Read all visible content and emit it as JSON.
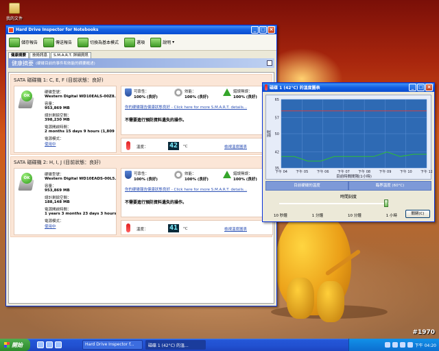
{
  "desktop": {
    "icon_label": "我的文件",
    "stamp": "#1970"
  },
  "main_window": {
    "title": "Hard Drive Inspector for Notebooks",
    "toolbar": [
      {
        "label": "儲存報告"
      },
      {
        "label": "傳送報告"
      },
      {
        "label": "切換為基本模式"
      },
      {
        "label": "選項"
      },
      {
        "label": "說明"
      }
    ],
    "tabs": [
      "健康摘要",
      "技術訊息",
      "S.M.A.R.T. 詳細資訊"
    ],
    "banner_title": "健康摘要",
    "banner_sub": "(硬碟目前的事件和效能的摘要概述)",
    "disks": [
      {
        "header": "SATA 磁碟機 1: C, E, F (目前狀態：良好)",
        "status": "OK",
        "model_label": "硬碟型號：",
        "model": "Western Digital WD10EALS-00Z8...",
        "capacity_label": "容量：",
        "capacity": "953,869 MB",
        "free_label": "總計剩餘空間：",
        "free": "398,230 MB",
        "power_label": "電源開啟時間：",
        "power": "2 months 15 days 9 hours (1,809 ...",
        "mode_label": "電源模式：",
        "mode": "使用中",
        "reliability_label": "可靠性：",
        "reliability": "100% (良好)",
        "performance_label": "效能：",
        "performance": "100% (良好)",
        "errorless_label": "錯誤無誤：",
        "errorless": "100% (良好)",
        "smart_link": "你的硬碟報告健康狀態良好 - Click here for more S.M.A.R.T. details...",
        "advice": "不需要進行預防資料遺失的操作。",
        "temp_label": "溫度：",
        "temp": "42",
        "temp_unit": "°C",
        "temp_link": "檢視溫度圖表"
      },
      {
        "header": "SATA 磁碟機 2: H, I, J (目前狀態：良好)",
        "status": "OK",
        "model_label": "硬碟型號：",
        "model": "Western Digital WD10EADS-00L5...",
        "capacity_label": "容量：",
        "capacity": "953,869 MB",
        "free_label": "總計剩餘空間：",
        "free": "188,148 MB",
        "power_label": "電源開啟時間：",
        "power": "1 years 3 months 23 days 3 hours ...",
        "mode_label": "電源模式：",
        "mode": "使用中",
        "reliability_label": "可靠性：",
        "reliability": "100% (良好)",
        "performance_label": "效能：",
        "performance": "100% (良好)",
        "errorless_label": "錯誤無誤：",
        "errorless": "100% (良好)",
        "smart_link": "你的硬碟報告健康狀態良好 - Click here for more S.M.A.R.T. details...",
        "advice": "不需要進行預防資料遺失的操作。",
        "temp_label": "溫度：",
        "temp": "41",
        "temp_unit": "°C",
        "temp_link": "檢視溫度圖表"
      }
    ]
  },
  "temp_window": {
    "title": "磁碟 1 (42°C) 的溫度圖表",
    "ylabel": "溫度",
    "xlabel": "目前時間間隔(1小時)",
    "legend_current": "目前硬碟的溫度",
    "legend_critical": "臨界溫度 (60°C)",
    "slider_label": "時間刻度",
    "ticks": [
      "10 秒鐘",
      "1 分鐘",
      "10 分鐘",
      "1 小時"
    ],
    "close_button": "關閉(C)"
  },
  "chart_data": {
    "type": "line",
    "ylabel": "溫度",
    "xlabel": "目前時間間隔(1小時)",
    "ylim": [
      35,
      65
    ],
    "yticks": [
      35,
      42,
      50,
      57,
      65
    ],
    "categories": [
      "下午 04",
      "下午 05",
      "下午 06",
      "下午 07",
      "下午 08",
      "下午 09",
      "下午 10",
      "下午 11"
    ],
    "series": [
      {
        "name": "目前硬碟的溫度",
        "color": "#30c030",
        "values": [
          40,
          40,
          38,
          38,
          40,
          40,
          40,
          40,
          42,
          40,
          41,
          41
        ]
      },
      {
        "name": "臨界溫度 (60°C)",
        "color": "#d04040",
        "values": [
          60,
          60
        ]
      }
    ],
    "grid": true
  },
  "taskbar": {
    "start": "開始",
    "tasks": [
      {
        "label": "Hard Drive Inspector f..."
      },
      {
        "label": "磁碟 1 (42°C) 的溫..."
      }
    ],
    "clock": "下午 04:20"
  }
}
